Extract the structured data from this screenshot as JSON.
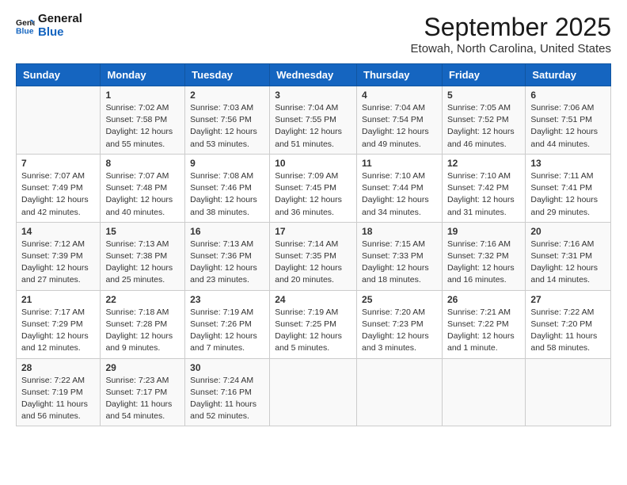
{
  "header": {
    "logo_line1": "General",
    "logo_line2": "Blue",
    "month": "September 2025",
    "location": "Etowah, North Carolina, United States"
  },
  "weekdays": [
    "Sunday",
    "Monday",
    "Tuesday",
    "Wednesday",
    "Thursday",
    "Friday",
    "Saturday"
  ],
  "weeks": [
    [
      {
        "day": "",
        "sunrise": "",
        "sunset": "",
        "daylight": ""
      },
      {
        "day": "1",
        "sunrise": "Sunrise: 7:02 AM",
        "sunset": "Sunset: 7:58 PM",
        "daylight": "Daylight: 12 hours and 55 minutes."
      },
      {
        "day": "2",
        "sunrise": "Sunrise: 7:03 AM",
        "sunset": "Sunset: 7:56 PM",
        "daylight": "Daylight: 12 hours and 53 minutes."
      },
      {
        "day": "3",
        "sunrise": "Sunrise: 7:04 AM",
        "sunset": "Sunset: 7:55 PM",
        "daylight": "Daylight: 12 hours and 51 minutes."
      },
      {
        "day": "4",
        "sunrise": "Sunrise: 7:04 AM",
        "sunset": "Sunset: 7:54 PM",
        "daylight": "Daylight: 12 hours and 49 minutes."
      },
      {
        "day": "5",
        "sunrise": "Sunrise: 7:05 AM",
        "sunset": "Sunset: 7:52 PM",
        "daylight": "Daylight: 12 hours and 46 minutes."
      },
      {
        "day": "6",
        "sunrise": "Sunrise: 7:06 AM",
        "sunset": "Sunset: 7:51 PM",
        "daylight": "Daylight: 12 hours and 44 minutes."
      }
    ],
    [
      {
        "day": "7",
        "sunrise": "Sunrise: 7:07 AM",
        "sunset": "Sunset: 7:49 PM",
        "daylight": "Daylight: 12 hours and 42 minutes."
      },
      {
        "day": "8",
        "sunrise": "Sunrise: 7:07 AM",
        "sunset": "Sunset: 7:48 PM",
        "daylight": "Daylight: 12 hours and 40 minutes."
      },
      {
        "day": "9",
        "sunrise": "Sunrise: 7:08 AM",
        "sunset": "Sunset: 7:46 PM",
        "daylight": "Daylight: 12 hours and 38 minutes."
      },
      {
        "day": "10",
        "sunrise": "Sunrise: 7:09 AM",
        "sunset": "Sunset: 7:45 PM",
        "daylight": "Daylight: 12 hours and 36 minutes."
      },
      {
        "day": "11",
        "sunrise": "Sunrise: 7:10 AM",
        "sunset": "Sunset: 7:44 PM",
        "daylight": "Daylight: 12 hours and 34 minutes."
      },
      {
        "day": "12",
        "sunrise": "Sunrise: 7:10 AM",
        "sunset": "Sunset: 7:42 PM",
        "daylight": "Daylight: 12 hours and 31 minutes."
      },
      {
        "day": "13",
        "sunrise": "Sunrise: 7:11 AM",
        "sunset": "Sunset: 7:41 PM",
        "daylight": "Daylight: 12 hours and 29 minutes."
      }
    ],
    [
      {
        "day": "14",
        "sunrise": "Sunrise: 7:12 AM",
        "sunset": "Sunset: 7:39 PM",
        "daylight": "Daylight: 12 hours and 27 minutes."
      },
      {
        "day": "15",
        "sunrise": "Sunrise: 7:13 AM",
        "sunset": "Sunset: 7:38 PM",
        "daylight": "Daylight: 12 hours and 25 minutes."
      },
      {
        "day": "16",
        "sunrise": "Sunrise: 7:13 AM",
        "sunset": "Sunset: 7:36 PM",
        "daylight": "Daylight: 12 hours and 23 minutes."
      },
      {
        "day": "17",
        "sunrise": "Sunrise: 7:14 AM",
        "sunset": "Sunset: 7:35 PM",
        "daylight": "Daylight: 12 hours and 20 minutes."
      },
      {
        "day": "18",
        "sunrise": "Sunrise: 7:15 AM",
        "sunset": "Sunset: 7:33 PM",
        "daylight": "Daylight: 12 hours and 18 minutes."
      },
      {
        "day": "19",
        "sunrise": "Sunrise: 7:16 AM",
        "sunset": "Sunset: 7:32 PM",
        "daylight": "Daylight: 12 hours and 16 minutes."
      },
      {
        "day": "20",
        "sunrise": "Sunrise: 7:16 AM",
        "sunset": "Sunset: 7:31 PM",
        "daylight": "Daylight: 12 hours and 14 minutes."
      }
    ],
    [
      {
        "day": "21",
        "sunrise": "Sunrise: 7:17 AM",
        "sunset": "Sunset: 7:29 PM",
        "daylight": "Daylight: 12 hours and 12 minutes."
      },
      {
        "day": "22",
        "sunrise": "Sunrise: 7:18 AM",
        "sunset": "Sunset: 7:28 PM",
        "daylight": "Daylight: 12 hours and 9 minutes."
      },
      {
        "day": "23",
        "sunrise": "Sunrise: 7:19 AM",
        "sunset": "Sunset: 7:26 PM",
        "daylight": "Daylight: 12 hours and 7 minutes."
      },
      {
        "day": "24",
        "sunrise": "Sunrise: 7:19 AM",
        "sunset": "Sunset: 7:25 PM",
        "daylight": "Daylight: 12 hours and 5 minutes."
      },
      {
        "day": "25",
        "sunrise": "Sunrise: 7:20 AM",
        "sunset": "Sunset: 7:23 PM",
        "daylight": "Daylight: 12 hours and 3 minutes."
      },
      {
        "day": "26",
        "sunrise": "Sunrise: 7:21 AM",
        "sunset": "Sunset: 7:22 PM",
        "daylight": "Daylight: 12 hours and 1 minute."
      },
      {
        "day": "27",
        "sunrise": "Sunrise: 7:22 AM",
        "sunset": "Sunset: 7:20 PM",
        "daylight": "Daylight: 11 hours and 58 minutes."
      }
    ],
    [
      {
        "day": "28",
        "sunrise": "Sunrise: 7:22 AM",
        "sunset": "Sunset: 7:19 PM",
        "daylight": "Daylight: 11 hours and 56 minutes."
      },
      {
        "day": "29",
        "sunrise": "Sunrise: 7:23 AM",
        "sunset": "Sunset: 7:17 PM",
        "daylight": "Daylight: 11 hours and 54 minutes."
      },
      {
        "day": "30",
        "sunrise": "Sunrise: 7:24 AM",
        "sunset": "Sunset: 7:16 PM",
        "daylight": "Daylight: 11 hours and 52 minutes."
      },
      {
        "day": "",
        "sunrise": "",
        "sunset": "",
        "daylight": ""
      },
      {
        "day": "",
        "sunrise": "",
        "sunset": "",
        "daylight": ""
      },
      {
        "day": "",
        "sunrise": "",
        "sunset": "",
        "daylight": ""
      },
      {
        "day": "",
        "sunrise": "",
        "sunset": "",
        "daylight": ""
      }
    ]
  ]
}
